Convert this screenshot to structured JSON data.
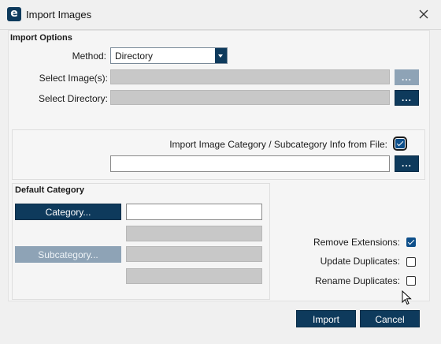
{
  "window": {
    "app_icon_letter": "e",
    "title": "Import Images"
  },
  "import_options": {
    "heading": "Import Options",
    "method_label": "Method:",
    "method_value": "Directory",
    "select_images_label": "Select Image(s):",
    "select_directory_label": "Select Directory:",
    "browse_label": "..."
  },
  "category_info": {
    "label": "Import Image Category / Subcategory Info from File:",
    "checked": true,
    "browse_label": "..."
  },
  "default_category": {
    "heading": "Default Category",
    "category_button": "Category...",
    "subcategory_button": "Subcategory..."
  },
  "options": {
    "remove_extensions": {
      "label": "Remove Extensions:",
      "checked": true
    },
    "update_duplicates": {
      "label": "Update Duplicates:",
      "checked": false
    },
    "rename_duplicates": {
      "label": "Rename Duplicates:",
      "checked": false
    }
  },
  "footer": {
    "import_label": "Import",
    "cancel_label": "Cancel"
  },
  "icons": {
    "app": "app-logo-icon",
    "close": "close-icon",
    "dropdown": "chevron-down-icon",
    "cursor": "mouse-pointer-icon"
  },
  "colors": {
    "accent": "#0e3a5c",
    "checkbox_checked": "#0e4f8a",
    "disabled_button": "#8ea3b6"
  }
}
